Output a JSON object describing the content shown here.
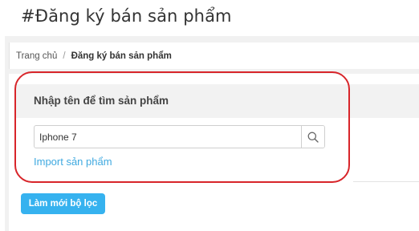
{
  "page_heading": "#Đăng ký bán sản phẩm",
  "breadcrumb": {
    "home": "Trang chủ",
    "separator": "/",
    "current": "Đăng ký bán sản phẩm"
  },
  "panel": {
    "title": "Nhập tên để tìm sản phẩm",
    "search": {
      "value": "Iphone 7",
      "icon": "search-icon"
    },
    "import_link": "Import sản phẩm"
  },
  "actions": {
    "reset_filter_label": "Làm mới bộ lọc"
  },
  "colors": {
    "accent": "#36b2ef",
    "link": "#3fa9e0",
    "annotation": "#d8252a"
  }
}
